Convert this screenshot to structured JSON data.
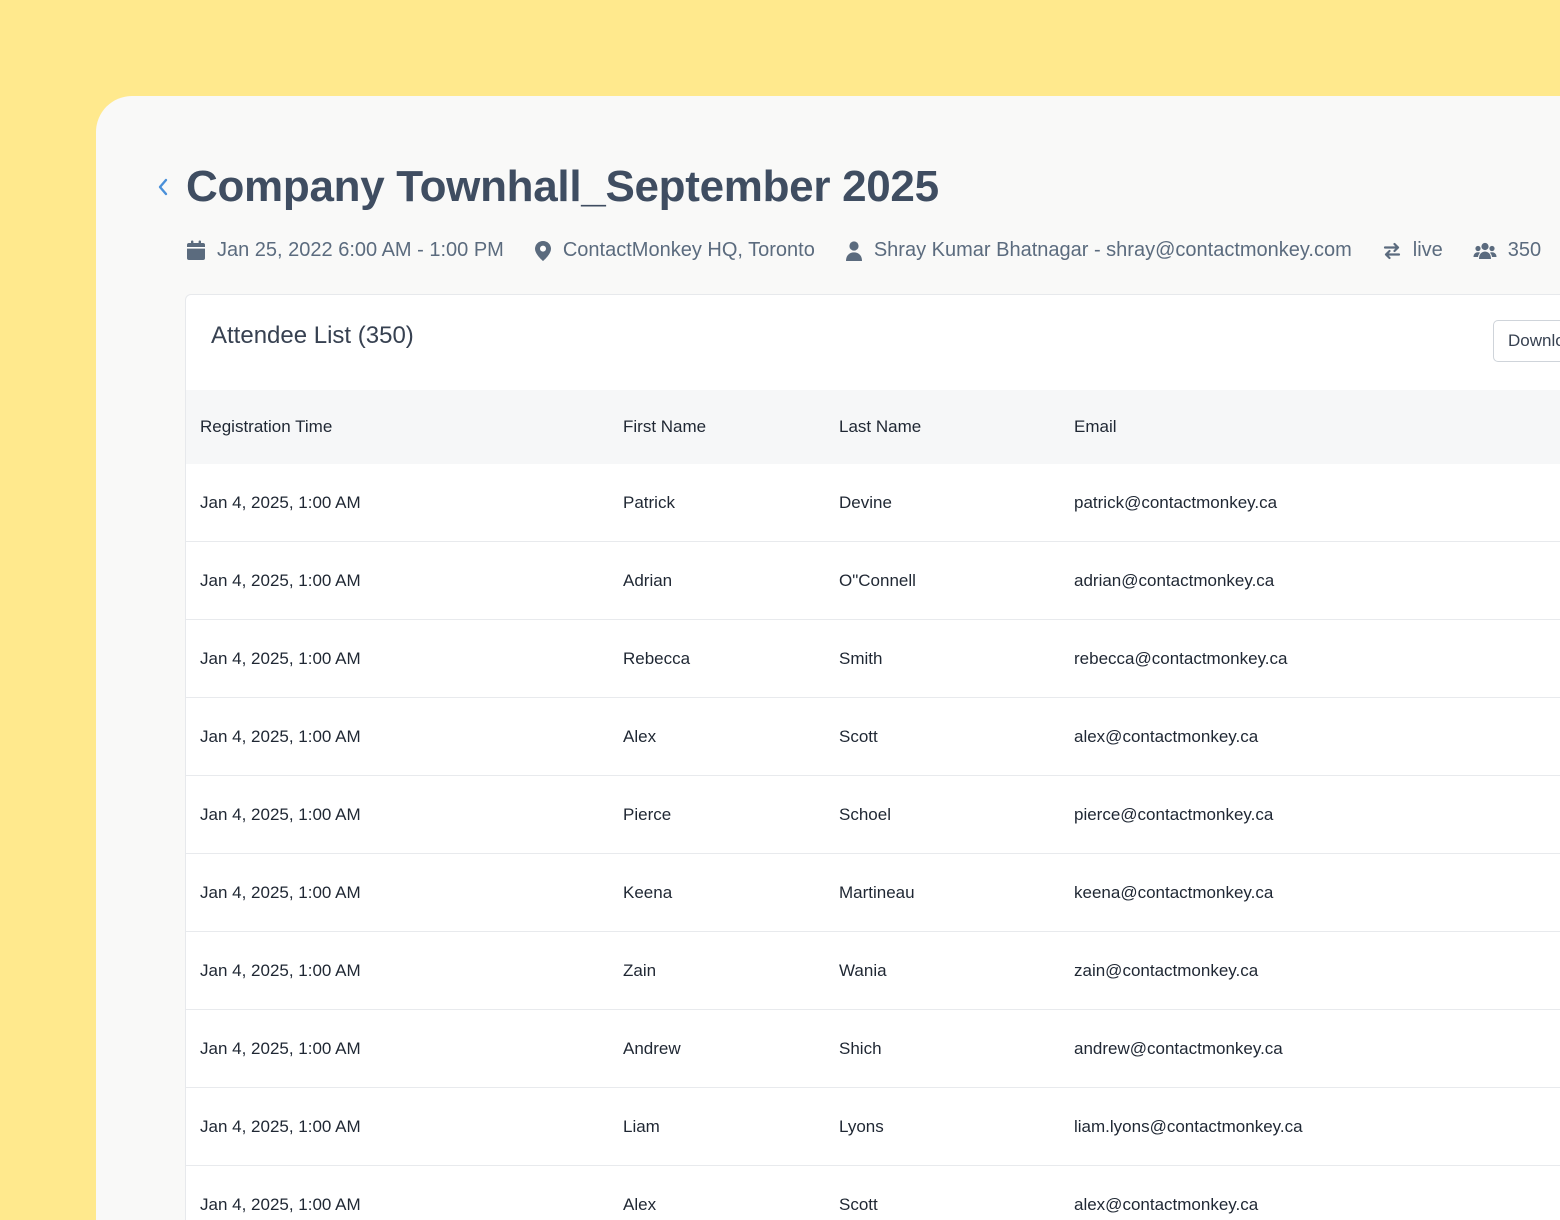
{
  "event": {
    "title": "Company Townhall_September 2025",
    "date_range": "Jan 25, 2022 6:00 AM - 1:00 PM",
    "location": "ContactMonkey HQ, Toronto",
    "organizer": "Shray Kumar Bhatnagar - shray@contactmonkey.com",
    "status": "live",
    "attendee_count": "350"
  },
  "attendees": {
    "title": "Attendee List (350)",
    "download_label": "Download",
    "columns": [
      "Registration Time",
      "First Name",
      "Last Name",
      "Email"
    ],
    "rows": [
      [
        "Jan 4, 2025, 1:00 AM",
        "Patrick",
        "Devine",
        "patrick@contactmonkey.ca"
      ],
      [
        "Jan 4, 2025, 1:00 AM",
        "Adrian",
        "O\"Connell",
        "adrian@contactmonkey.ca"
      ],
      [
        "Jan 4, 2025, 1:00 AM",
        "Rebecca",
        "Smith",
        "rebecca@contactmonkey.ca"
      ],
      [
        "Jan 4, 2025, 1:00 AM",
        "Alex",
        "Scott",
        "alex@contactmonkey.ca"
      ],
      [
        "Jan 4, 2025, 1:00 AM",
        "Pierce",
        "Schoel",
        "pierce@contactmonkey.ca"
      ],
      [
        "Jan 4, 2025, 1:00 AM",
        "Keena",
        "Martineau",
        "keena@contactmonkey.ca"
      ],
      [
        "Jan 4, 2025, 1:00 AM",
        "Zain",
        "Wania",
        "zain@contactmonkey.ca"
      ],
      [
        "Jan 4, 2025, 1:00 AM",
        "Andrew",
        "Shich",
        "andrew@contactmonkey.ca"
      ],
      [
        "Jan 4, 2025, 1:00 AM",
        "Liam",
        "Lyons",
        "liam.lyons@contactmonkey.ca"
      ],
      [
        "Jan 4, 2025, 1:00 AM",
        "Alex",
        "Scott",
        "alex@contactmonkey.ca"
      ]
    ]
  },
  "colors": {
    "background": "#FFE98D",
    "panel": "#F9F9F8",
    "title_text": "#3f4d61",
    "accent_blue": "#4a90d9"
  },
  "icons": {
    "back": "chevron-left-icon",
    "date": "calendar-icon",
    "location": "map-pin-icon",
    "organizer": "user-icon",
    "status": "swap-arrows-icon",
    "attendees": "users-group-icon"
  }
}
